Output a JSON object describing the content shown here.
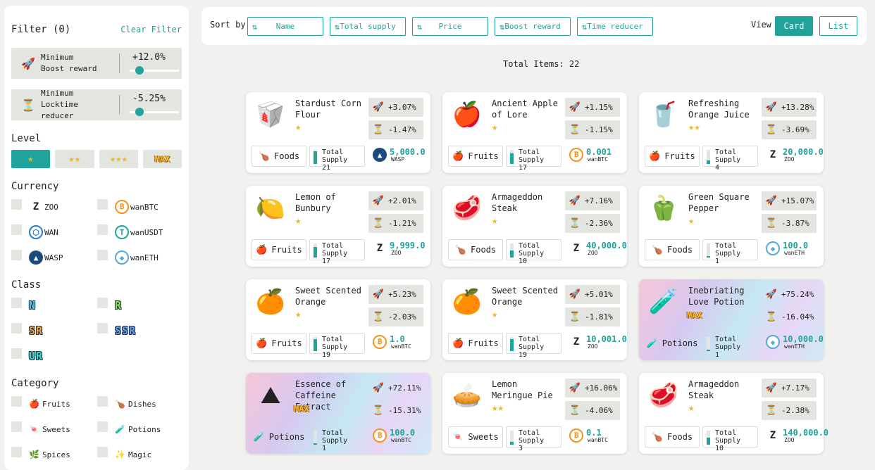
{
  "filter": {
    "title": "Filter (0)",
    "clear_label": "Clear Filter",
    "boost": {
      "label1": "Minimum",
      "label2": "Boost reward",
      "value": "+12.0%",
      "fraction": 0.2
    },
    "locktime": {
      "label1": "Minimum",
      "label2": "Locktime reducer",
      "value": "-5.25%",
      "fraction": 0.2
    },
    "level_title": "Level",
    "levels": [
      {
        "stars": "★",
        "active": true
      },
      {
        "stars": "★★",
        "active": false
      },
      {
        "stars": "★★★",
        "active": false
      },
      {
        "stars": "MAX",
        "active": false
      }
    ],
    "currency_title": "Currency",
    "currencies": [
      {
        "label": "ZOO",
        "icon": "zoo-icon",
        "glyph": "Z",
        "cls": "ic-zoo"
      },
      {
        "label": "wanBTC",
        "icon": "bitcoin-icon",
        "glyph": "₿",
        "cls": "ic-btc"
      },
      {
        "label": "WAN",
        "icon": "wan-icon",
        "glyph": "⬡",
        "cls": "ic-wan"
      },
      {
        "label": "wanUSDT",
        "icon": "tether-icon",
        "glyph": "T",
        "cls": "ic-usdt"
      },
      {
        "label": "WASP",
        "icon": "wasp-icon",
        "glyph": "▲",
        "cls": "ic-wasp"
      },
      {
        "label": "wanETH",
        "icon": "ethereum-icon",
        "glyph": "◆",
        "cls": "ic-eth"
      }
    ],
    "class_title": "Class",
    "classes": [
      {
        "label": "N",
        "color": "#5bd0e0"
      },
      {
        "label": "R",
        "color": "#8de05b"
      },
      {
        "label": "SR",
        "color": "#f0a040"
      },
      {
        "label": "SSR",
        "color": "#6a9ce8"
      },
      {
        "label": "UR",
        "color": "#3bd7c8"
      }
    ],
    "category_title": "Category",
    "categories": [
      {
        "label": "Fruits",
        "icon": "apple-icon",
        "glyph": "🍎"
      },
      {
        "label": "Dishes",
        "icon": "drumstick-icon",
        "glyph": "🍗"
      },
      {
        "label": "Sweets",
        "icon": "candy-icon",
        "glyph": "🍬"
      },
      {
        "label": "Potions",
        "icon": "potion-icon",
        "glyph": "🧪"
      },
      {
        "label": "Spices",
        "icon": "leaf-icon",
        "glyph": "🌿"
      },
      {
        "label": "Magic",
        "icon": "magic-icon",
        "glyph": "✨"
      }
    ]
  },
  "topbar": {
    "sort_label": "Sort by",
    "sorts": [
      "Name",
      "Total supply",
      "Price",
      "Boost reward",
      "Time reducer"
    ],
    "view_label": "View",
    "view_card": "Card",
    "view_list": "List"
  },
  "total_items": "Total Items: 22",
  "supply_label": "Total Supply",
  "colors": {
    "accent": "#1fa39a",
    "panel": "#e3e5e0",
    "star": "#e9b929"
  },
  "cards": [
    {
      "name": "Stardust Corn Flour",
      "glyph": "🥡",
      "icon": "flour-sack-icon",
      "stars": "★",
      "max": false,
      "boost": "+3.07%",
      "lock": "-1.47%",
      "category": "Foods",
      "cat_glyph": "🍗",
      "supply": "21",
      "supply_fill": 0.9,
      "price": "5,000.0",
      "currency": "WASP",
      "cur_glyph": "▲",
      "cur_cls": "ic-wasp",
      "holo": false
    },
    {
      "name": "Ancient Apple of Lore",
      "glyph": "🍎",
      "icon": "apple-icon",
      "stars": "★",
      "max": false,
      "boost": "+1.15%",
      "lock": "-1.15%",
      "category": "Fruits",
      "cat_glyph": "🍎",
      "supply": "17",
      "supply_fill": 0.75,
      "price": "0.001",
      "currency": "wanBTC",
      "cur_glyph": "₿",
      "cur_cls": "ic-btc",
      "holo": false
    },
    {
      "name": "Refreshing Orange Juice",
      "glyph": "🥤",
      "icon": "juice-icon",
      "stars": "★★",
      "max": false,
      "boost": "+13.28%",
      "lock": "-3.69%",
      "category": "Fruits",
      "cat_glyph": "🍎",
      "supply": "4",
      "supply_fill": 0.25,
      "price": "20,000.0",
      "currency": "ZOO",
      "cur_glyph": "Z",
      "cur_cls": "ic-zoo",
      "holo": false
    },
    {
      "name": "Lemon of Bunbury",
      "glyph": "🍋",
      "icon": "lemon-icon",
      "stars": "★",
      "max": false,
      "boost": "+2.01%",
      "lock": "-1.21%",
      "category": "Fruits",
      "cat_glyph": "🍎",
      "supply": "17",
      "supply_fill": 0.75,
      "price": "9,999.0",
      "currency": "ZOO",
      "cur_glyph": "Z",
      "cur_cls": "ic-zoo",
      "holo": false
    },
    {
      "name": "Armageddon Steak",
      "glyph": "🥩",
      "icon": "steak-icon",
      "stars": "★",
      "max": false,
      "boost": "+7.16%",
      "lock": "-2.36%",
      "category": "Foods",
      "cat_glyph": "🍗",
      "supply": "10",
      "supply_fill": 0.5,
      "price": "40,000.0",
      "currency": "ZOO",
      "cur_glyph": "Z",
      "cur_cls": "ic-zoo",
      "holo": false
    },
    {
      "name": "Green Square Pepper",
      "glyph": "🫑",
      "icon": "pepper-icon",
      "stars": "★",
      "max": false,
      "boost": "+15.07%",
      "lock": "-3.87%",
      "category": "Foods",
      "cat_glyph": "🍗",
      "supply": "1",
      "supply_fill": 0.1,
      "price": "100.0",
      "currency": "wanETH",
      "cur_glyph": "◆",
      "cur_cls": "ic-eth",
      "holo": false
    },
    {
      "name": "Sweet Scented Orange",
      "glyph": "🍊",
      "icon": "orange-icon",
      "stars": "★",
      "max": false,
      "boost": "+5.23%",
      "lock": "-2.03%",
      "category": "Fruits",
      "cat_glyph": "🍎",
      "supply": "19",
      "supply_fill": 0.85,
      "price": "1.0",
      "currency": "wanBTC",
      "cur_glyph": "₿",
      "cur_cls": "ic-btc",
      "holo": false
    },
    {
      "name": "Sweet Scented Orange",
      "glyph": "🍊",
      "icon": "orange-icon",
      "stars": "★",
      "max": false,
      "boost": "+5.01%",
      "lock": "-1.81%",
      "category": "Fruits",
      "cat_glyph": "🍎",
      "supply": "19",
      "supply_fill": 0.85,
      "price": "10,001.0",
      "currency": "ZOO",
      "cur_glyph": "Z",
      "cur_cls": "ic-zoo",
      "holo": false
    },
    {
      "name": "Inebriating Love Potion",
      "glyph": "🧪",
      "icon": "love-potion-icon",
      "stars": "",
      "max": true,
      "max_label": "MAX",
      "boost": "+75.24%",
      "lock": "-16.04%",
      "category": "Potions",
      "cat_glyph": "🧪",
      "supply": "1",
      "supply_fill": 0.1,
      "price": "10,000.0",
      "currency": "wanETH",
      "cur_glyph": "◆",
      "cur_cls": "ic-eth",
      "holo": true
    },
    {
      "name": "Essence of Caffeine Extract",
      "glyph": "⛰",
      "icon": "coffee-powder-icon",
      "stars": "",
      "max": true,
      "max_label": "MAX",
      "boost": "+72.11%",
      "lock": "-15.31%",
      "category": "Potions",
      "cat_glyph": "🧪",
      "supply": "1",
      "supply_fill": 0.1,
      "price": "100.0",
      "currency": "wanBTC",
      "cur_glyph": "₿",
      "cur_cls": "ic-btc",
      "holo": true
    },
    {
      "name": "Lemon Meringue Pie",
      "glyph": "🥧",
      "icon": "pie-icon",
      "stars": "★★",
      "max": false,
      "boost": "+16.06%",
      "lock": "-4.06%",
      "category": "Sweets",
      "cat_glyph": "🍬",
      "supply": "3",
      "supply_fill": 0.2,
      "price": "0.1",
      "currency": "wanBTC",
      "cur_glyph": "₿",
      "cur_cls": "ic-btc",
      "holo": false
    },
    {
      "name": "Armageddon Steak",
      "glyph": "🥩",
      "icon": "steak-icon",
      "stars": "★",
      "max": false,
      "boost": "+7.17%",
      "lock": "-2.38%",
      "category": "Foods",
      "cat_glyph": "🍗",
      "supply": "10",
      "supply_fill": 0.5,
      "price": "140,000.0",
      "currency": "ZOO",
      "cur_glyph": "Z",
      "cur_cls": "ic-zoo",
      "holo": false
    }
  ]
}
